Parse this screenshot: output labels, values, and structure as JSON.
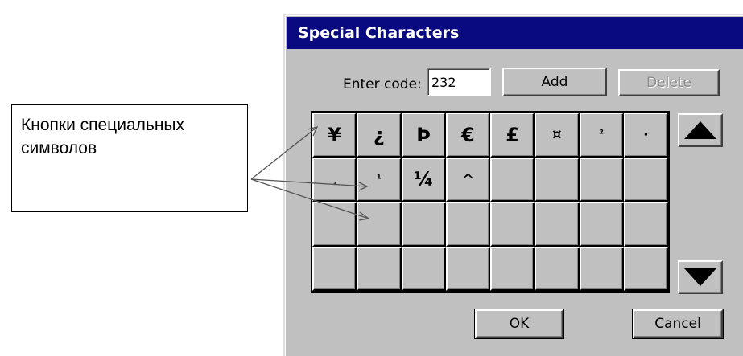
{
  "callout": {
    "line1": "Кнопки специальных",
    "line2": "символов"
  },
  "dialog": {
    "title": "Special Characters",
    "enter_code_label": "Enter code:",
    "code_value": "232",
    "add_label": "Add",
    "delete_label": "Delete",
    "ok_label": "OK",
    "cancel_label": "Cancel",
    "scroll_up_icon": "triangle-up-icon",
    "scroll_down_icon": "triangle-down-icon",
    "grid": [
      [
        "¥",
        "¿",
        "Þ",
        "€",
        "£",
        "¤",
        "²",
        "·"
      ],
      [
        "¸",
        "¹",
        "¼",
        "^",
        "",
        "",
        "",
        ""
      ],
      [
        "",
        "",
        "",
        "",
        "",
        "",
        "",
        ""
      ],
      [
        "",
        "",
        "",
        "",
        "",
        "",
        "",
        ""
      ]
    ]
  }
}
